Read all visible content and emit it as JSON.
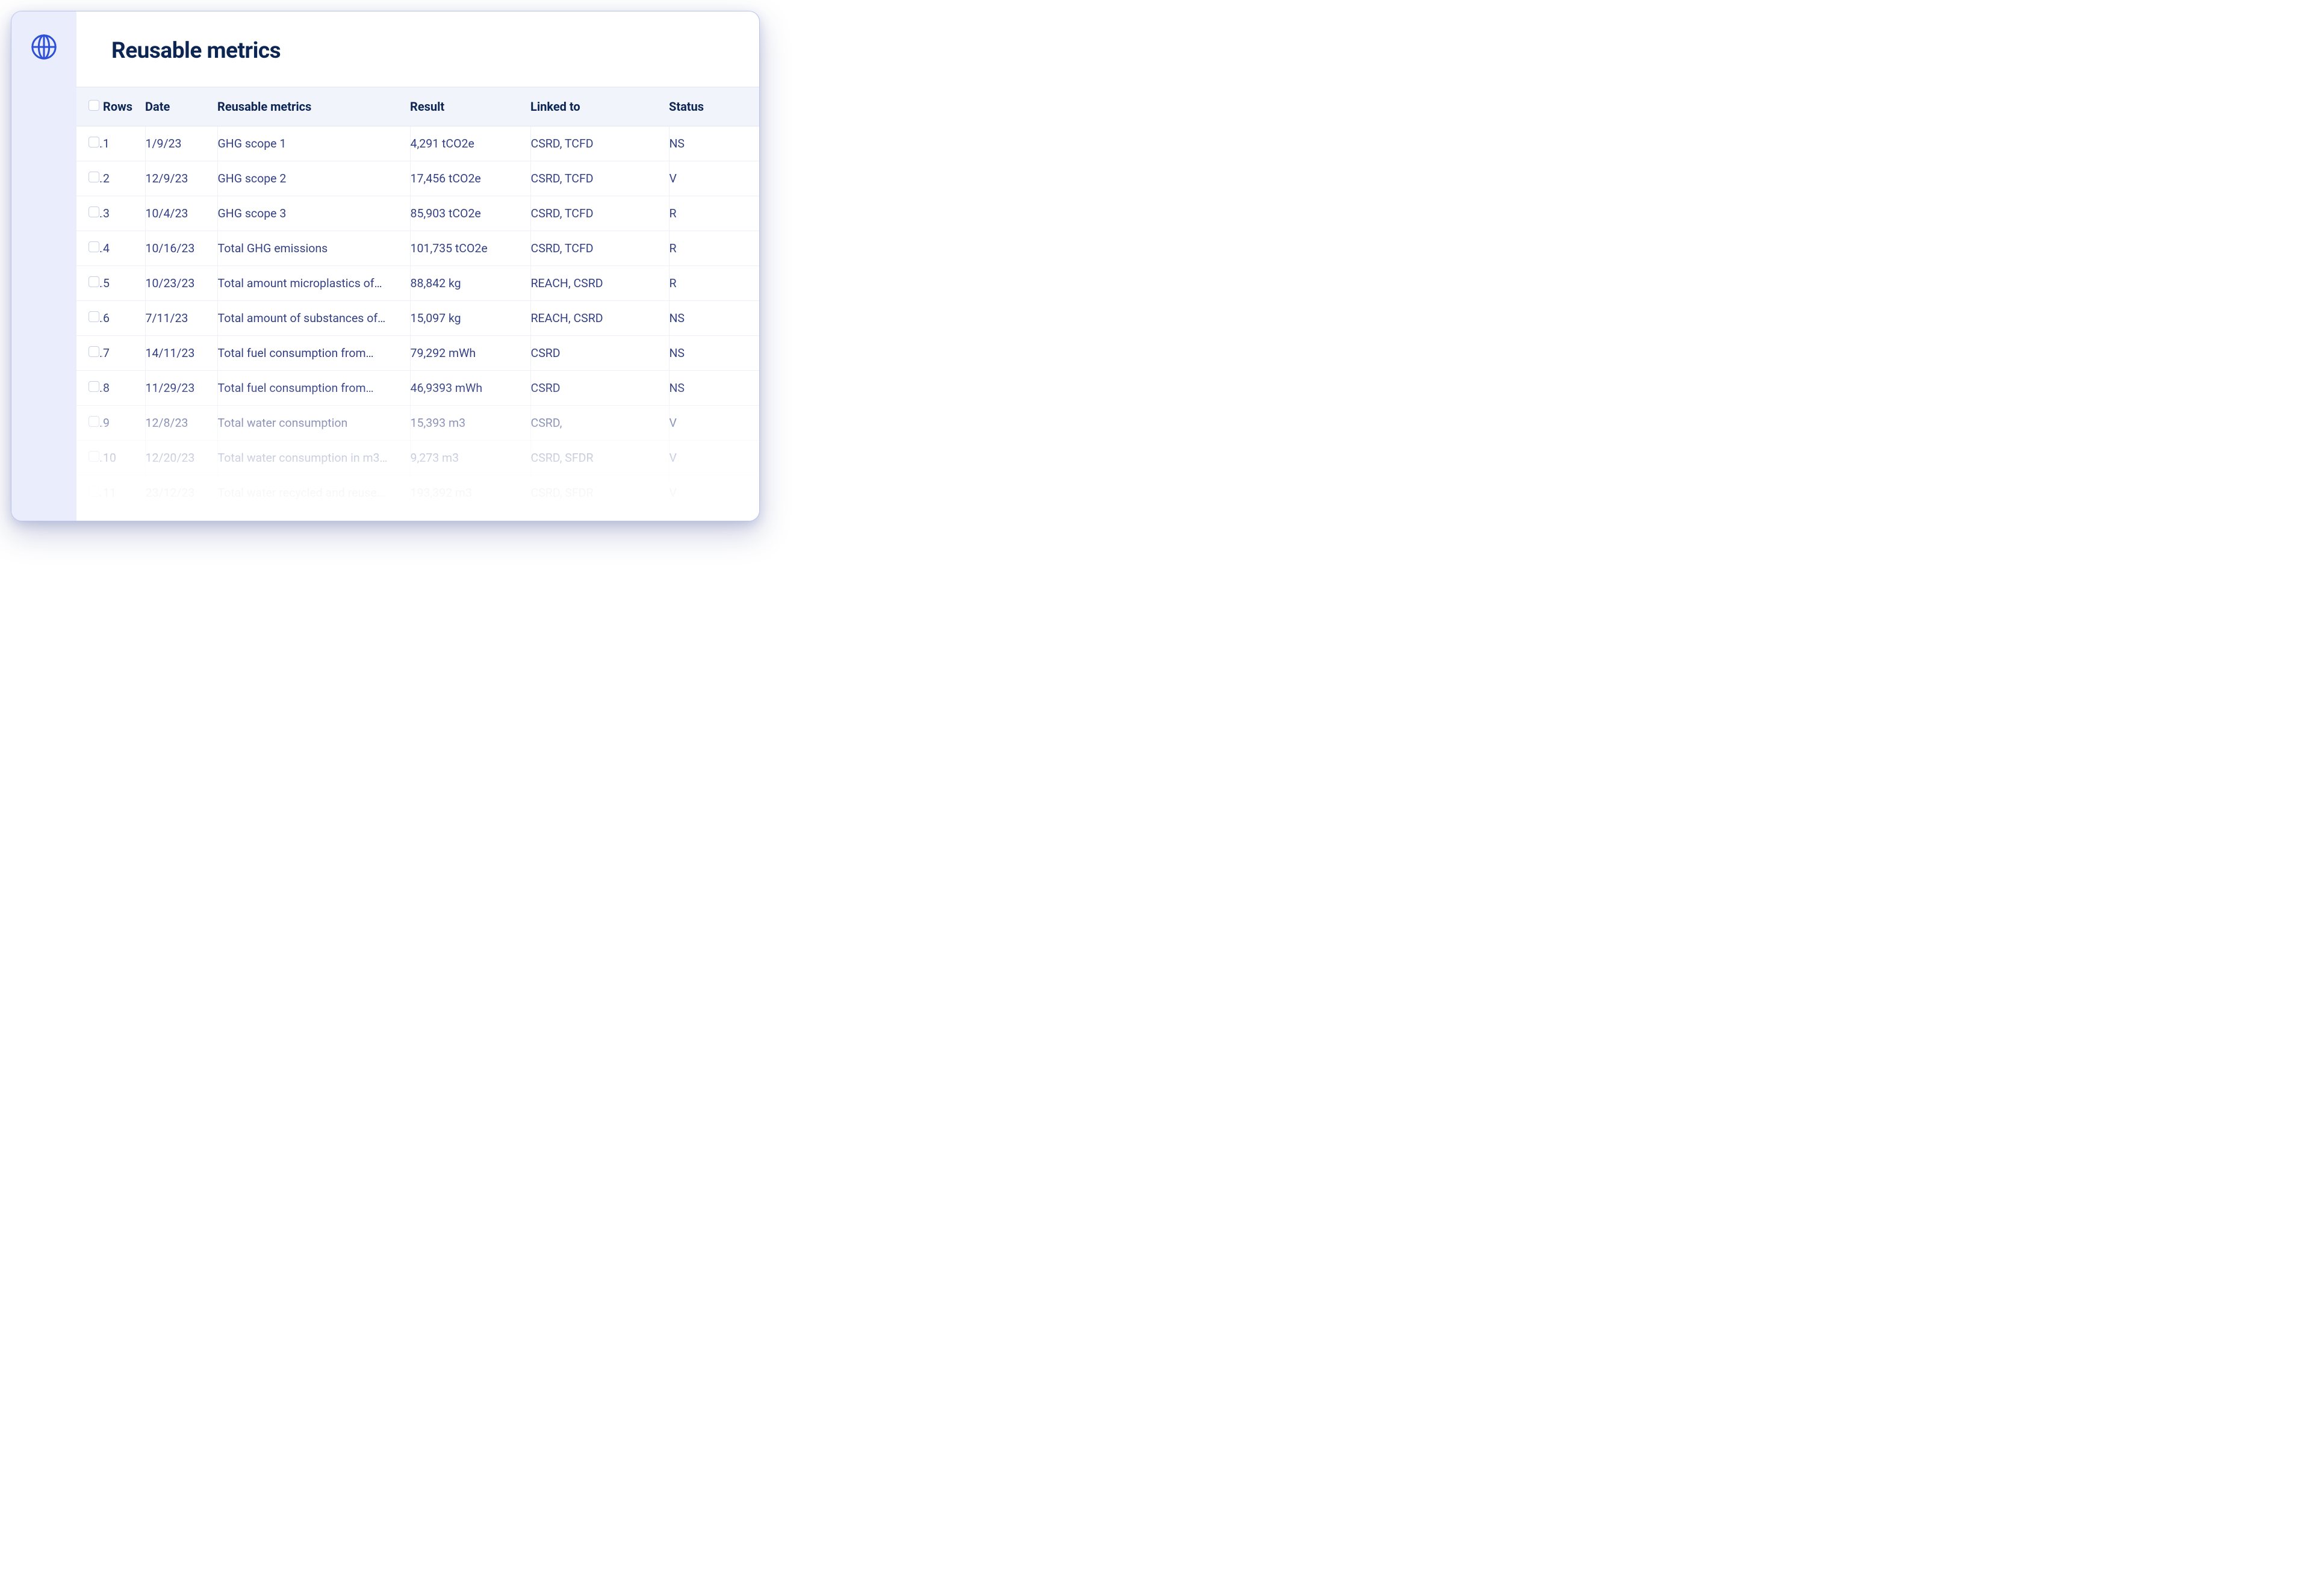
{
  "page_title": "Reusable metrics",
  "columns": {
    "rows": "Rows",
    "date": "Date",
    "metric": "Reusable metrics",
    "result": "Result",
    "linked": "Linked to",
    "status": "Status"
  },
  "rows": [
    {
      "n": "1",
      "date": "1/9/23",
      "metric": "GHG scope 1",
      "result": "4,291 tCO2e",
      "linked": "CSRD, TCFD",
      "status": "NS"
    },
    {
      "n": "2",
      "date": "12/9/23",
      "metric": "GHG scope 2",
      "result": "17,456 tCO2e",
      "linked": "CSRD, TCFD",
      "status": "V"
    },
    {
      "n": "3",
      "date": "10/4/23",
      "metric": "GHG scope 3",
      "result": "85,903 tCO2e",
      "linked": "CSRD, TCFD",
      "status": "R"
    },
    {
      "n": "4",
      "date": "10/16/23",
      "metric": "Total GHG emissions",
      "result": "101,735 tCO2e",
      "linked": "CSRD, TCFD",
      "status": "R"
    },
    {
      "n": "5",
      "date": "10/23/23",
      "metric": "Total amount microplastics of…",
      "result": "88,842 kg",
      "linked": "REACH, CSRD",
      "status": "R"
    },
    {
      "n": "6",
      "date": "7/11/23",
      "metric": "Total amount of substances of…",
      "result": "15,097 kg",
      "linked": "REACH, CSRD",
      "status": "NS"
    },
    {
      "n": "7",
      "date": "14/11/23",
      "metric": "Total fuel consumption from…",
      "result": "79,292 mWh",
      "linked": "CSRD",
      "status": "NS"
    },
    {
      "n": "8",
      "date": "11/29/23",
      "metric": "Total fuel consumption from…",
      "result": "46,9393 mWh",
      "linked": "CSRD",
      "status": "NS"
    },
    {
      "n": "9",
      "date": "12/8/23",
      "metric": "Total water consumption",
      "result": "15,393 m3",
      "linked": "CSRD,",
      "status": "V"
    },
    {
      "n": "10",
      "date": "12/20/23",
      "metric": "Total water consumption in m3…",
      "result": "9,273 m3",
      "linked": "CSRD, SFDR",
      "status": "V"
    },
    {
      "n": "11",
      "date": "23/12/23",
      "metric": "Total water recycled and reuse…",
      "result": "193,392 m3",
      "linked": "CSRD, SFDR",
      "status": "V"
    }
  ]
}
